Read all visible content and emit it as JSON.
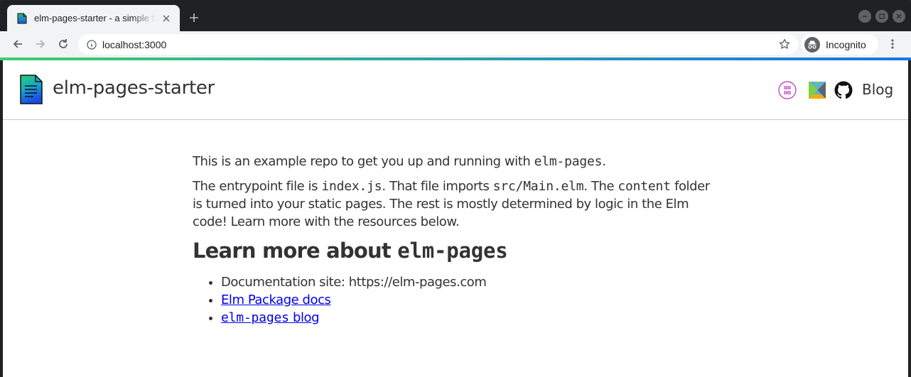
{
  "browser": {
    "tab": {
      "title": "elm-pages-starter - a simple blog starter"
    },
    "address": "localhost:3000",
    "profile": "Incognito",
    "icons": {
      "back": "arrow-left-icon",
      "forward": "arrow-right-icon",
      "reload": "reload-icon",
      "info": "info-icon",
      "bookmark": "star-icon",
      "menu": "kebab-menu-icon",
      "new_tab": "plus-icon",
      "close_tab": "close-icon"
    },
    "accent_gradient": [
      "#3ad06b",
      "#1a73e8"
    ]
  },
  "site": {
    "title": "elm-pages-starter",
    "logo": "document-logo-icon",
    "nav": {
      "graphql_icon": "github-sponsors-icon",
      "elm_icon": "elm-package-icon",
      "github_icon": "github-icon",
      "blog": "Blog"
    }
  },
  "content": {
    "intro": {
      "before": "This is an example repo to get you up and running with ",
      "code": "elm-pages",
      "after": "."
    },
    "entry": {
      "t1": "The entrypoint file is ",
      "c1": "index.js",
      "t2": ". That file imports ",
      "c2": "src/Main.elm",
      "t3": ". The ",
      "c3": "content",
      "t4": " folder is turned into your static pages. The rest is mostly determined by logic in the Elm code! Learn more with the resources below."
    },
    "heading": {
      "text": "Learn more about ",
      "code": "elm-pages"
    },
    "links": {
      "docs_site": "Documentation site: https://elm-pages.com",
      "package_docs": "Elm Package docs",
      "blog_code": "elm-pages",
      "blog_suffix": " blog"
    }
  },
  "colors": {
    "link": "#0000ee",
    "text": "#333333"
  }
}
